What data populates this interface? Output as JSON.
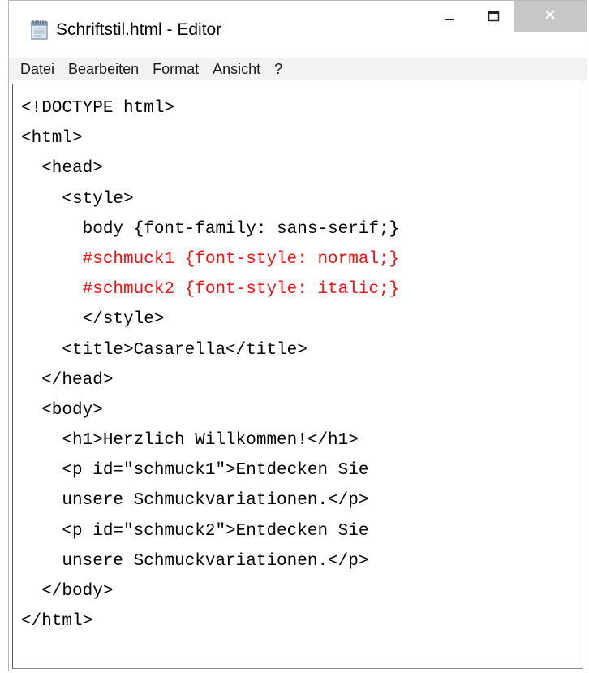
{
  "window": {
    "title": "Schriftstil.html - Editor"
  },
  "menu": {
    "items": [
      "Datei",
      "Bearbeiten",
      "Format",
      "Ansicht",
      "?"
    ]
  },
  "editor": {
    "lines": [
      "<!DOCTYPE html>",
      "<html>",
      "  <head>",
      "    <style>",
      "      body {font-family: sans-serif;}",
      "      #schmuck1 {font-style: normal;}",
      "      #schmuck2 {font-style: italic;}",
      "      </style>",
      "    <title>Casarella</title>",
      "  </head>",
      "  <body>",
      "    <h1>Herzlich Willkommen!</h1>",
      "    <p id=\"schmuck1\">Entdecken Sie",
      "    unsere Schmuckvariationen.</p>",
      "    <p id=\"schmuck2\">Entdecken Sie",
      "    unsere Schmuckvariationen.</p>",
      "  </body>",
      "</html>"
    ],
    "highlight_color": "#ee1111"
  },
  "icons": {
    "app": "notepad-icon",
    "minimize": "minimize-icon",
    "maximize": "maximize-icon",
    "close": "close-icon"
  }
}
